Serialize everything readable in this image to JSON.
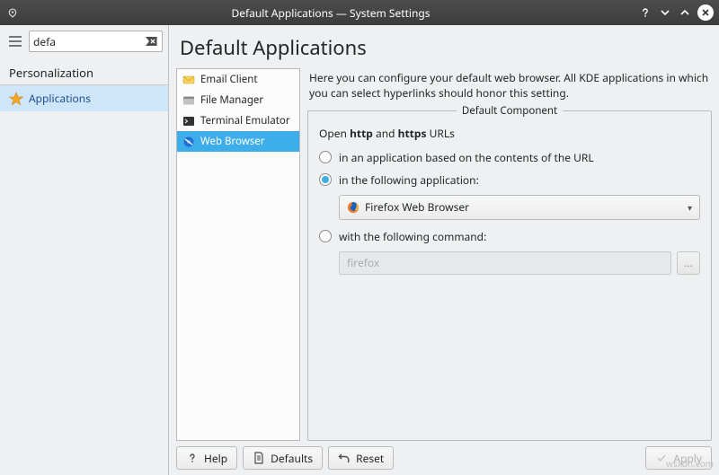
{
  "window": {
    "title": "Default Applications — System Settings"
  },
  "search": {
    "value": "defa"
  },
  "sidebar": {
    "category": "Personalization",
    "items": [
      {
        "label": "Applications"
      }
    ]
  },
  "page": {
    "title": "Default Applications",
    "description": "Here you can configure your default web browser. All KDE applications in which you can select hyperlinks should honor this setting."
  },
  "components": [
    {
      "label": "Email Client"
    },
    {
      "label": "File Manager"
    },
    {
      "label": "Terminal Emulator"
    },
    {
      "label": "Web Browser"
    }
  ],
  "frame": {
    "title": "Default Component",
    "open_prefix": "Open ",
    "open_mid": " and ",
    "open_suffix": " URLs",
    "http": "http",
    "https": "https",
    "radio1": "in an application based on the contents of the URL",
    "radio2": "in the following application:",
    "radio3": "with the following command:",
    "selected_app": "Firefox Web Browser",
    "cmd_placeholder": "firefox",
    "browse_label": "..."
  },
  "buttons": {
    "help": "Help",
    "defaults": "Defaults",
    "reset": "Reset",
    "apply": "Apply"
  },
  "watermark": "wsxdn.com"
}
